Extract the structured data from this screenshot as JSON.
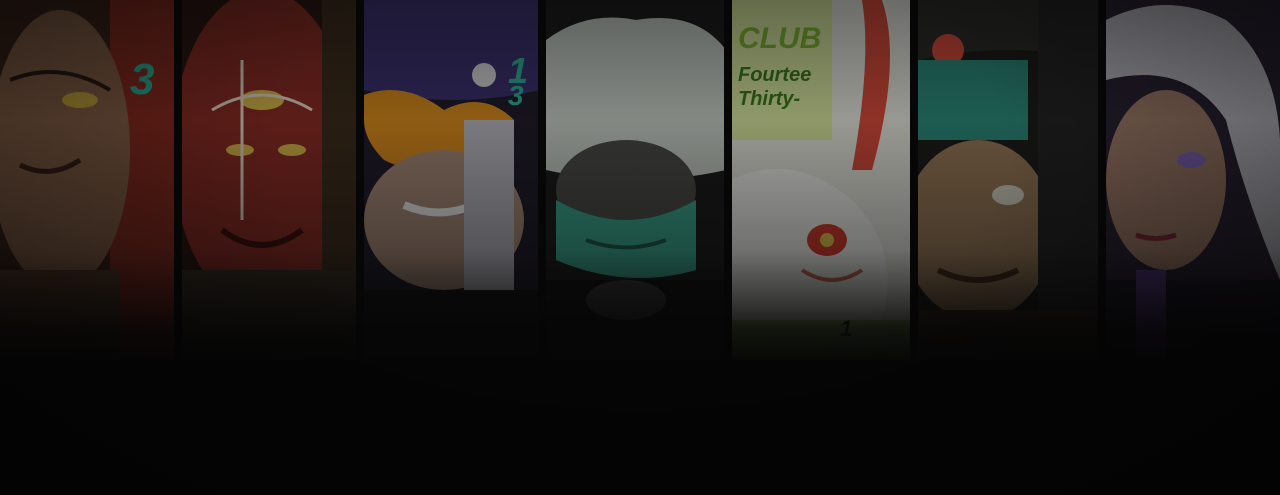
{
  "banner": {
    "poster_number_a": "3",
    "poster_number_b": "1",
    "poster_number_c": "3",
    "poster_club": "CLUB",
    "poster_line1": "Fourtee",
    "poster_line2": "Thirty-",
    "poster_badge": "1"
  },
  "colors": {
    "background": "#050505",
    "accent_green": "#7fb832",
    "accent_teal": "#2bb59a",
    "accent_red": "#c03a2a",
    "accent_purple": "#7a4fb0"
  },
  "characters": [
    {
      "id": "bald-man",
      "icon": "portrait-bald-man"
    },
    {
      "id": "red-demon",
      "icon": "portrait-red-demon"
    },
    {
      "id": "flame-face",
      "icon": "portrait-flame-face"
    },
    {
      "id": "masked-figure",
      "icon": "portrait-masked-figure"
    },
    {
      "id": "white-rabbit",
      "icon": "portrait-white-rabbit"
    },
    {
      "id": "old-woman",
      "icon": "portrait-old-woman"
    },
    {
      "id": "silver-hair-woman",
      "icon": "portrait-silver-hair-woman"
    }
  ]
}
